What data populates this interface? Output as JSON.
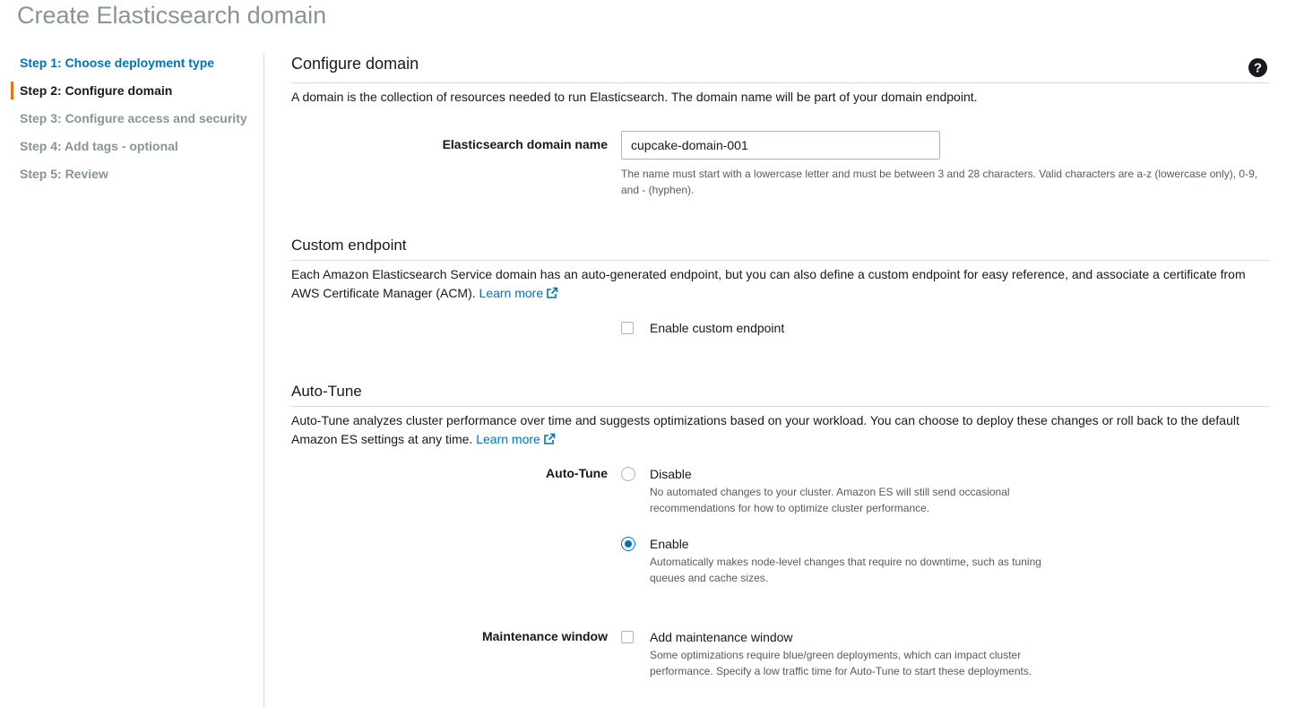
{
  "page": {
    "title": "Create Elasticsearch domain"
  },
  "steps": [
    {
      "label": "Step 1: Choose deployment type",
      "state": "done"
    },
    {
      "label": "Step 2: Configure domain",
      "state": "current"
    },
    {
      "label": "Step 3: Configure access and security",
      "state": "upcoming"
    },
    {
      "label": "Step 4: Add tags - optional",
      "state": "upcoming"
    },
    {
      "label": "Step 5: Review",
      "state": "upcoming"
    }
  ],
  "configure_domain": {
    "title": "Configure domain",
    "description": "A domain is the collection of resources needed to run Elasticsearch. The domain name will be part of your domain endpoint.",
    "help_icon": "help-circle-icon",
    "domain_name_label": "Elasticsearch domain name",
    "domain_name_value": "cupcake-domain-001",
    "domain_name_hint_line1": "The name must start with a lowercase letter and must be between 3 and 28 characters. Valid characters are a-z (lowercase only), 0-9,",
    "domain_name_hint_line2": "and - (hyphen)."
  },
  "custom_endpoint": {
    "title": "Custom endpoint",
    "description_line1": "Each Amazon Elasticsearch Service domain has an auto-generated endpoint, but you can also define a custom endpoint for easy reference, and associate a certificate from",
    "description_line2": "AWS Certificate Manager (ACM).",
    "learn_more": "Learn more",
    "checkbox_label": "Enable custom endpoint",
    "checkbox_checked": false
  },
  "auto_tune": {
    "title": "Auto-Tune",
    "description_line1": "Auto-Tune analyzes cluster performance over time and suggests optimizations based on your workload. You can choose to deploy these changes or roll back to the default",
    "description_line2": "Amazon ES settings at any time.",
    "learn_more": "Learn more",
    "field_label": "Auto-Tune",
    "options": [
      {
        "label": "Disable",
        "desc_line1": "No automated changes to your cluster. Amazon ES will still send occasional",
        "desc_line2": "recommendations for how to optimize cluster performance.",
        "selected": false
      },
      {
        "label": "Enable",
        "desc_line1": "Automatically makes node-level changes that require no downtime, such as tuning",
        "desc_line2": "queues and cache sizes.",
        "selected": true
      }
    ],
    "maintenance_label": "Maintenance window",
    "maintenance_checkbox_label": "Add maintenance window",
    "maintenance_desc_line1": "Some optimizations require blue/green deployments, which can impact cluster",
    "maintenance_desc_line2": "performance. Specify a low traffic time for Auto-Tune to start these deployments.",
    "maintenance_checked": false
  },
  "colors": {
    "link": "#0073bb",
    "current_step_marker": "#ec7211",
    "muted": "#879596"
  }
}
